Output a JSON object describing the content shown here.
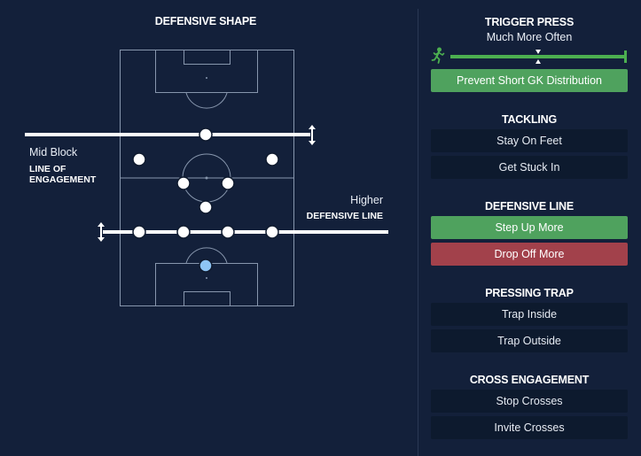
{
  "defensive_shape": {
    "title": "DEFENSIVE SHAPE",
    "line_of_engagement": {
      "value_label": "Mid Block",
      "label_line1": "LINE OF",
      "label_line2": "ENGAGEMENT"
    },
    "defensive_line": {
      "value_label": "Higher",
      "label": "DEFENSIVE LINE"
    }
  },
  "trigger_press": {
    "title": "TRIGGER PRESS",
    "value": "Much More Often",
    "level": 1.0,
    "icon": "running-player-icon",
    "toggle_label": "Prevent Short GK Distribution"
  },
  "tackling": {
    "title": "TACKLING",
    "options": [
      "Stay On Feet",
      "Get Stuck In"
    ]
  },
  "defensive_line": {
    "title": "DEFENSIVE LINE",
    "options": [
      "Step Up More",
      "Drop Off More"
    ]
  },
  "pressing_trap": {
    "title": "PRESSING TRAP",
    "options": [
      "Trap Inside",
      "Trap Outside"
    ]
  },
  "cross_engagement": {
    "title": "CROSS ENGAGEMENT",
    "options": [
      "Stop Crosses",
      "Invite Crosses"
    ]
  },
  "colors": {
    "background": "#13203a",
    "option_bg": "#0d1a2e",
    "active_green": "#4fa25e",
    "active_red": "#a2414b",
    "slider_green": "#4caf50",
    "goalkeeper": "#8ec5f5"
  }
}
